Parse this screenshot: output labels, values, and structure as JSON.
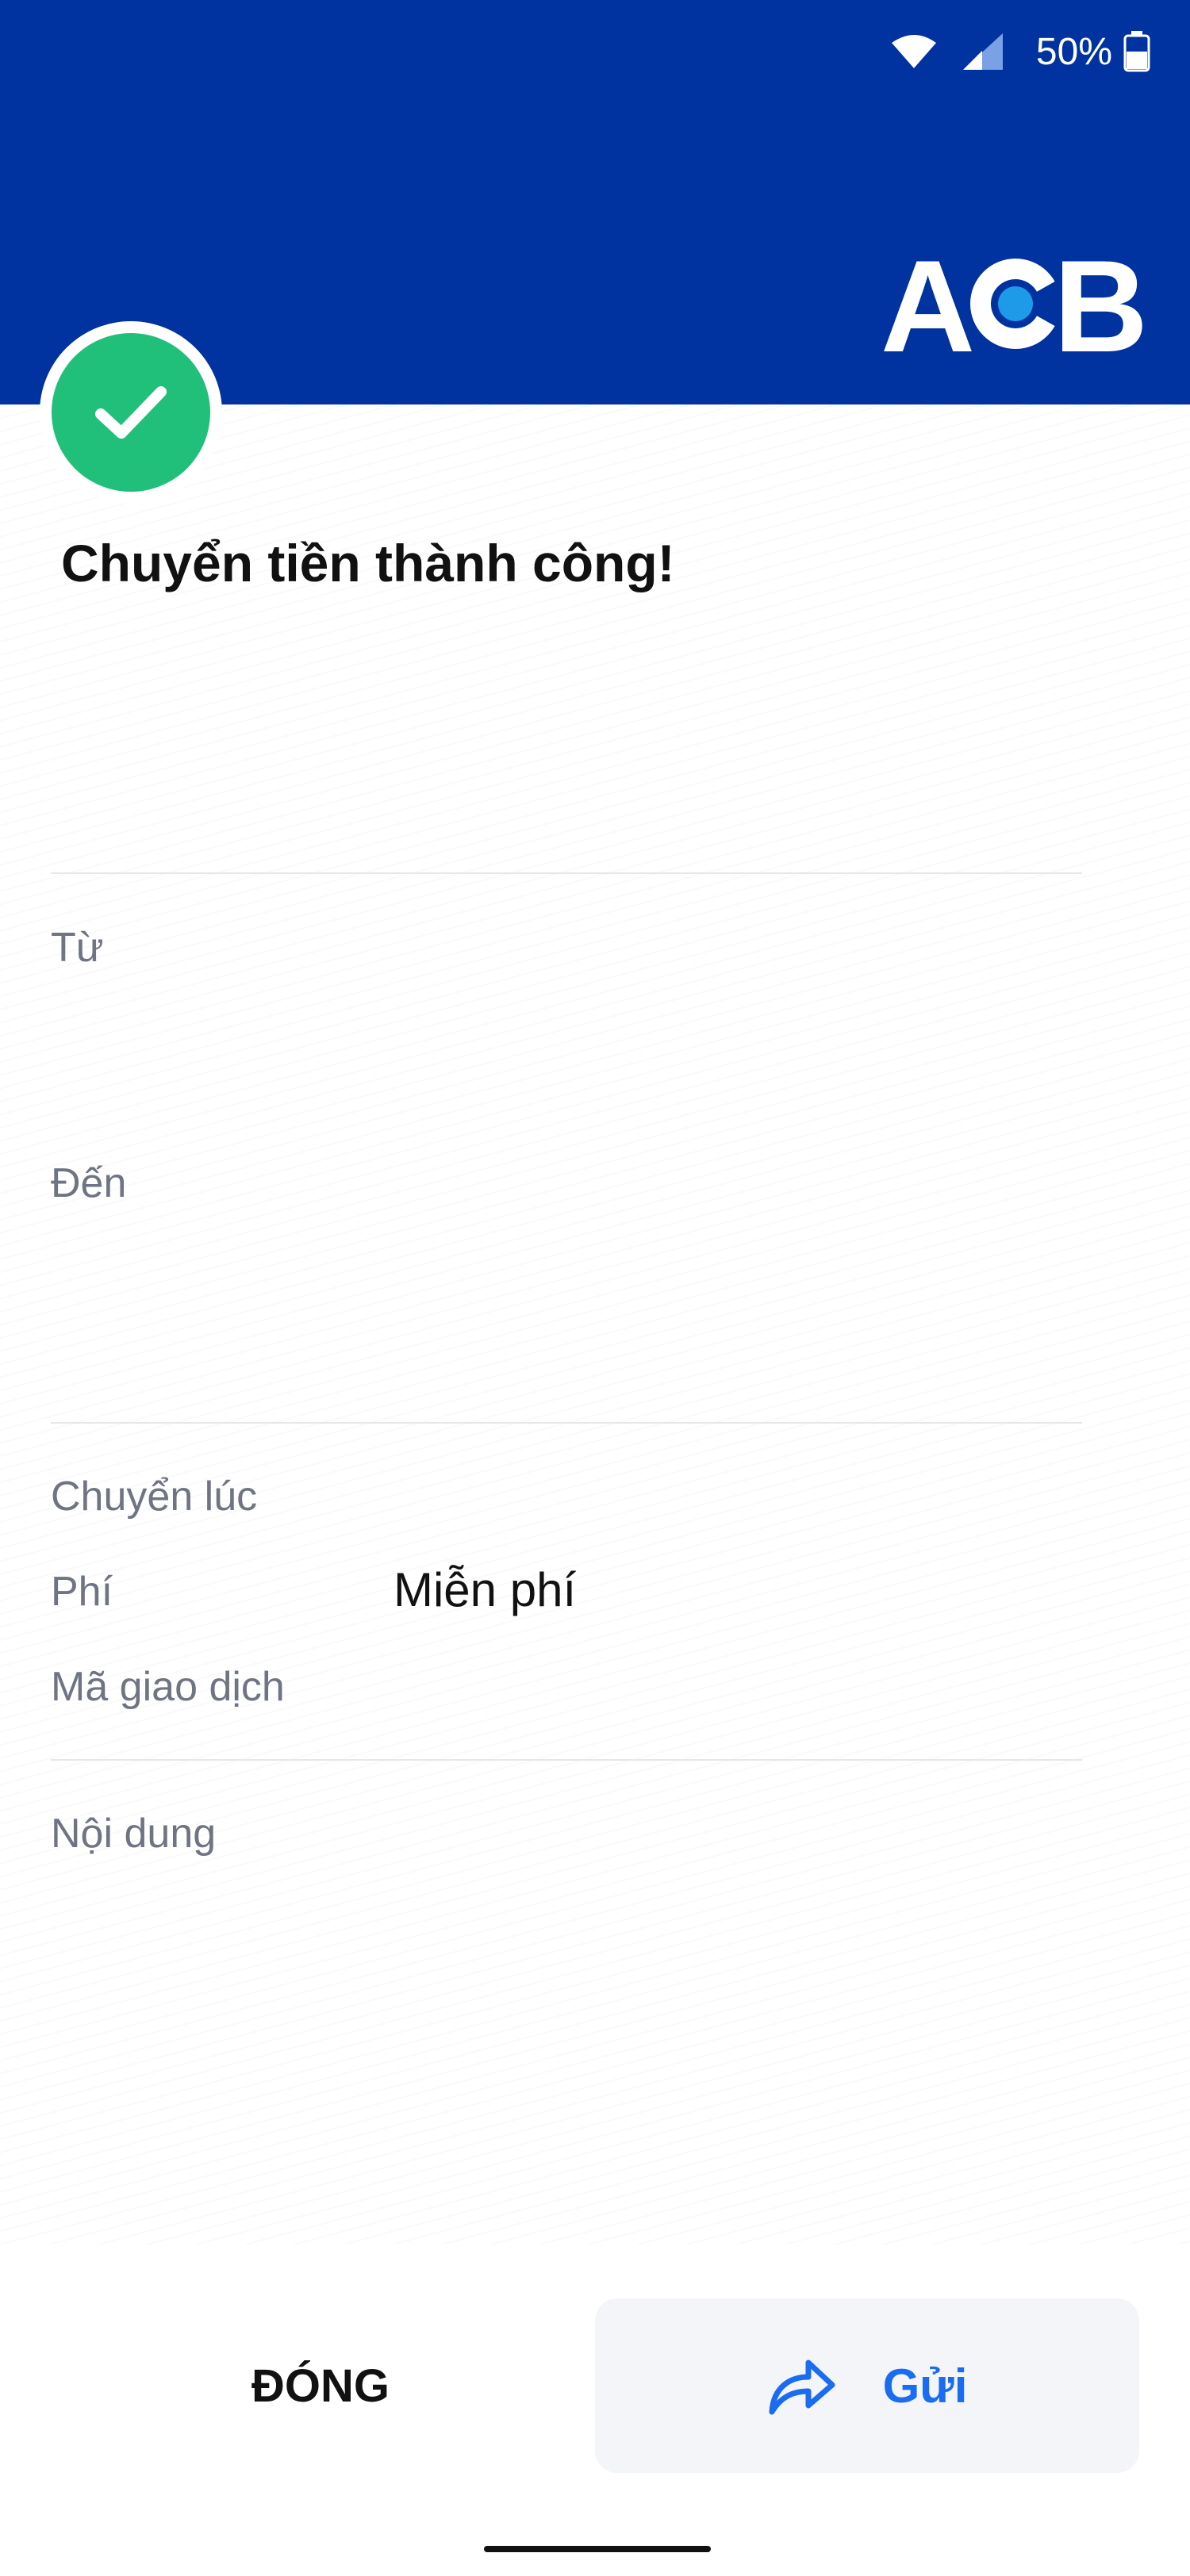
{
  "status_bar": {
    "battery": "50%"
  },
  "brand": {
    "logo_text_left": "A",
    "logo_text_right": "B"
  },
  "result": {
    "title": "Chuyển tiền thành công!"
  },
  "details": {
    "from_label": "Từ",
    "to_label": "Đến",
    "time_label": "Chuyển lúc",
    "fee_label": "Phí",
    "fee_value": "Miễn phí",
    "txn_label": "Mã giao dịch",
    "content_label": "Nội dung"
  },
  "actions": {
    "close": "ĐÓNG",
    "send": "Gửi"
  },
  "colors": {
    "header": "#0033a0",
    "success": "#21c07a",
    "accent": "#1a6cf0"
  }
}
